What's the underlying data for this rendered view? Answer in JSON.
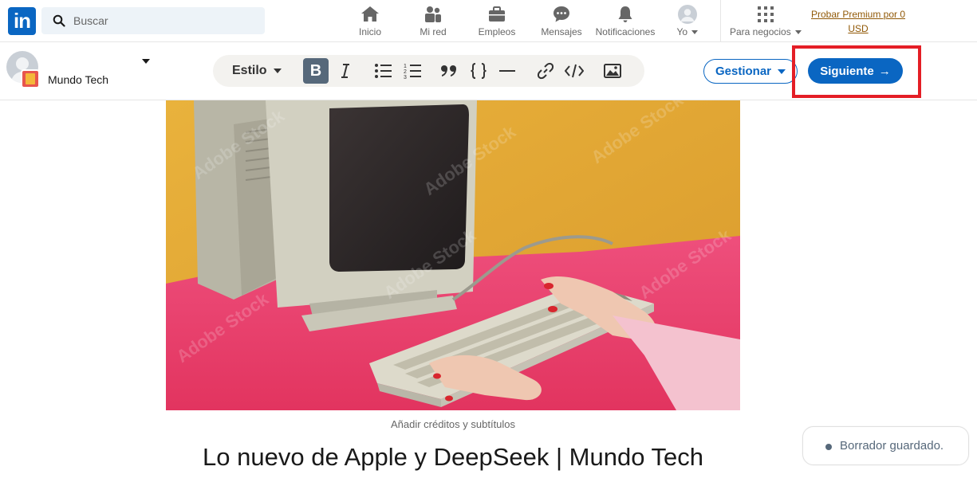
{
  "nav": {
    "logo_text": "in",
    "search_placeholder": "Buscar",
    "items": [
      {
        "label": "Inicio",
        "icon": "home-icon"
      },
      {
        "label": "Mi red",
        "icon": "network-icon"
      },
      {
        "label": "Empleos",
        "icon": "briefcase-icon"
      },
      {
        "label": "Mensajes",
        "icon": "messages-icon"
      },
      {
        "label": "Notificaciones",
        "icon": "bell-icon"
      },
      {
        "label": "Yo",
        "icon": "avatar"
      },
      {
        "label": "Para negocios",
        "icon": "grid-icon"
      }
    ],
    "premium_line1": "Probar Premium por 0",
    "premium_line2": "USD"
  },
  "editor": {
    "author_name": "Mundo Tech",
    "style_label": "Estilo",
    "bold_label": "B",
    "manage_label": "Gestionar",
    "next_label": "Siguiente",
    "next_arrow": "→"
  },
  "article": {
    "caption": "Añadir créditos y subtítulos",
    "title": "Lo nuevo de Apple y DeepSeek | Mundo Tech",
    "watermark": "Adobe Stock"
  },
  "toast": {
    "text": "Borrador guardado."
  },
  "colors": {
    "brand": "#0a66c2",
    "highlight": "#e41e26",
    "cover_wall": "#e2a635",
    "cover_table": "#e8386a"
  }
}
